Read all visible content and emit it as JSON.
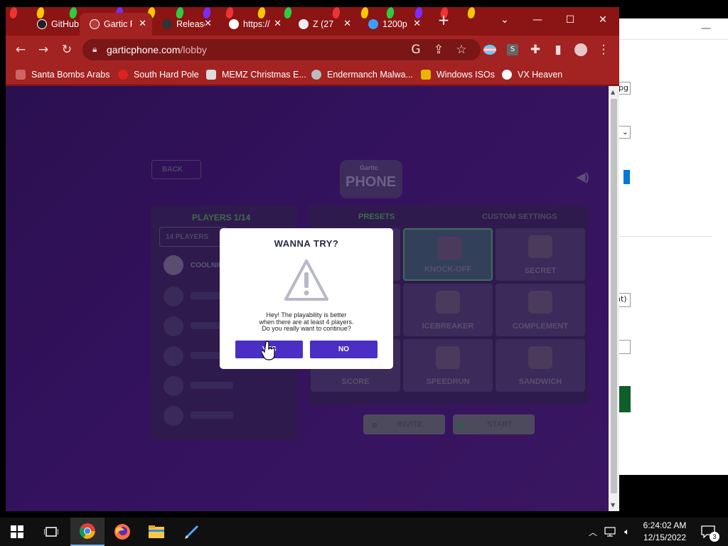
{
  "browser": {
    "tabs": [
      {
        "label": "GitHub",
        "active": false
      },
      {
        "label": "Gartic Phone",
        "active": true
      },
      {
        "label": "Releases",
        "active": false
      },
      {
        "label": "https://",
        "active": false
      },
      {
        "label": "Z (27",
        "active": false
      },
      {
        "label": "1200p",
        "active": false
      }
    ],
    "new_tab": "+",
    "window_controls": {
      "dropdown": "⌄",
      "minimize": "—",
      "maximize": "☐",
      "close": "✕"
    },
    "url_domain": "garticphone.com",
    "url_path": "/lobby",
    "bookmarks": [
      "Santa Bombs Arabs",
      "South Hard Pole",
      "MEMZ Christmas E...",
      "Endermanch Malwa...",
      "Windows ISOs",
      "VX Heaven"
    ],
    "colors": {
      "frame": "#8b1414",
      "toolbar": "#a32222"
    }
  },
  "game": {
    "back_label": "BACK",
    "logo_top": "Gartic",
    "logo_bottom": "PHONE",
    "players_header": "PLAYERS 1/14",
    "players_select": "14 PLAYERS",
    "host_name": "COOLNICK",
    "tab_presets": "PRESETS",
    "tab_custom": "CUSTOM SETTINGS",
    "presets": [
      "",
      "KNOCK-OFF",
      "SECRET",
      "",
      "ICEBREAKER",
      "COMPLEMENT",
      "SCORE",
      "SPEEDRUN",
      "SANDWICH"
    ],
    "invite_label": "INVITE",
    "start_label": "START"
  },
  "modal": {
    "title": "WANNA TRY?",
    "message_line1": "Hey! The playability is better",
    "message_line2": "when there are at least 4 players.",
    "message_line3": "Do you really want to continue?",
    "yes_label": "YES",
    "no_label": "NO",
    "accent": "#4b2fc4"
  },
  "background_window": {
    "field_1": "pg",
    "field_2": "nt)"
  },
  "taskbar": {
    "time": "6:24:02 AM",
    "date": "12/15/2022",
    "notification_count": "3"
  }
}
